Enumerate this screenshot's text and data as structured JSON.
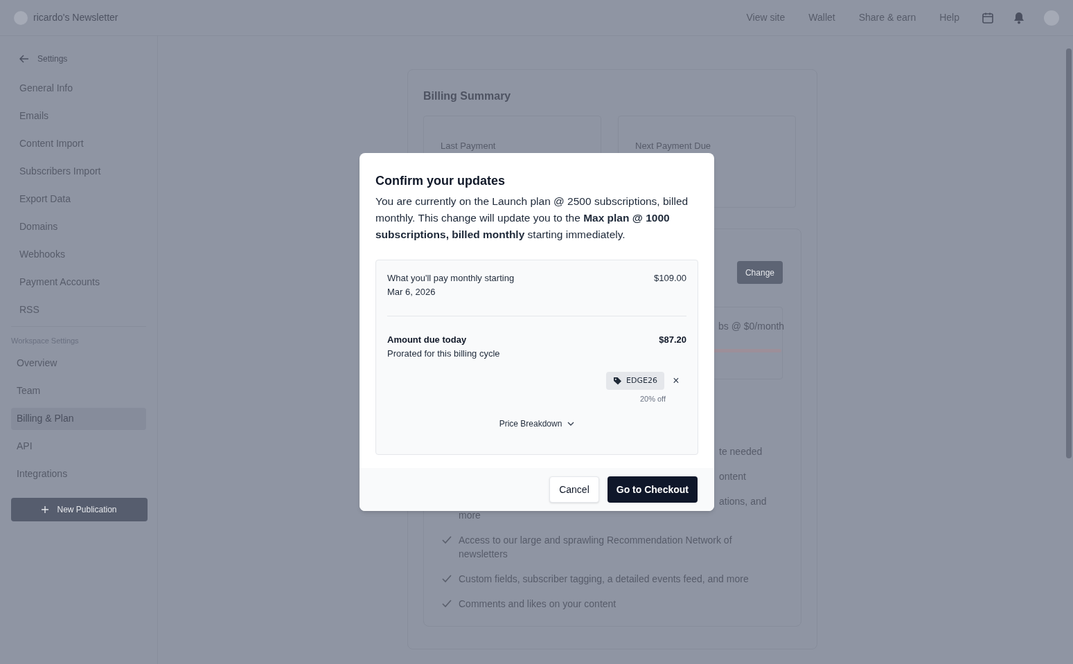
{
  "header": {
    "publication": "ricardo's Newsletter",
    "links": [
      "View site",
      "Wallet",
      "Share & earn",
      "Help"
    ]
  },
  "sidebar": {
    "back_label": "Settings",
    "publication_items": [
      {
        "label": "General Info",
        "selected": false
      },
      {
        "label": "Emails",
        "selected": false
      },
      {
        "label": "Content Import",
        "selected": false
      },
      {
        "label": "Subscribers Import",
        "selected": false
      },
      {
        "label": "Export Data",
        "selected": false
      },
      {
        "label": "Domains",
        "selected": false
      },
      {
        "label": "Webhooks",
        "selected": false
      },
      {
        "label": "Payment Accounts",
        "selected": false
      },
      {
        "label": "RSS",
        "selected": false
      }
    ],
    "workspace_heading": "Workspace Settings",
    "workspace_items": [
      {
        "label": "Overview",
        "selected": false
      },
      {
        "label": "Team",
        "selected": false
      },
      {
        "label": "Billing & Plan",
        "selected": true
      },
      {
        "label": "API",
        "selected": false
      },
      {
        "label": "Integrations",
        "selected": false
      }
    ],
    "new_button": "New Publication"
  },
  "billing": {
    "title": "Billing Summary",
    "stats": [
      "Last Payment",
      "Next Payment Due"
    ],
    "change_button": "Change",
    "plan_fragment": "bs @ $0/month",
    "features": [
      {
        "kind": "covered",
        "text": "te needed"
      },
      {
        "kind": "covered",
        "text": "ontent"
      },
      {
        "kind": "partly_covered",
        "text": "ations, and",
        "continuation": "more"
      },
      {
        "kind": "full",
        "text": "Access to our large and sprawling Recommendation Network of newsletters"
      },
      {
        "kind": "full",
        "text": "Custom fields, subscriber tagging, a detailed events feed, and more"
      },
      {
        "kind": "full",
        "text": "Comments and likes on your content"
      }
    ]
  },
  "modal": {
    "title": "Confirm your updates",
    "body": "You are currently on the Launch plan @ 2500 subscriptions, billed monthly. This change will update you to the **Max plan @ 1000 subscriptions, billed monthly** starting immediately.",
    "monthly": {
      "label": "What you'll pay monthly starting",
      "date": "Mar 6, 2026",
      "amount": "$109.00"
    },
    "due": {
      "label": "Amount due today",
      "note": "Prorated for this billing cycle",
      "amount": "$87.20"
    },
    "coupon": {
      "code": "EDGE26",
      "remove": "×",
      "discount": "20% off"
    },
    "breakdown": {
      "label": "Price Breakdown",
      "expanded": false
    },
    "buttons": {
      "cancel": "Cancel",
      "confirm": "Go to Checkout"
    }
  }
}
